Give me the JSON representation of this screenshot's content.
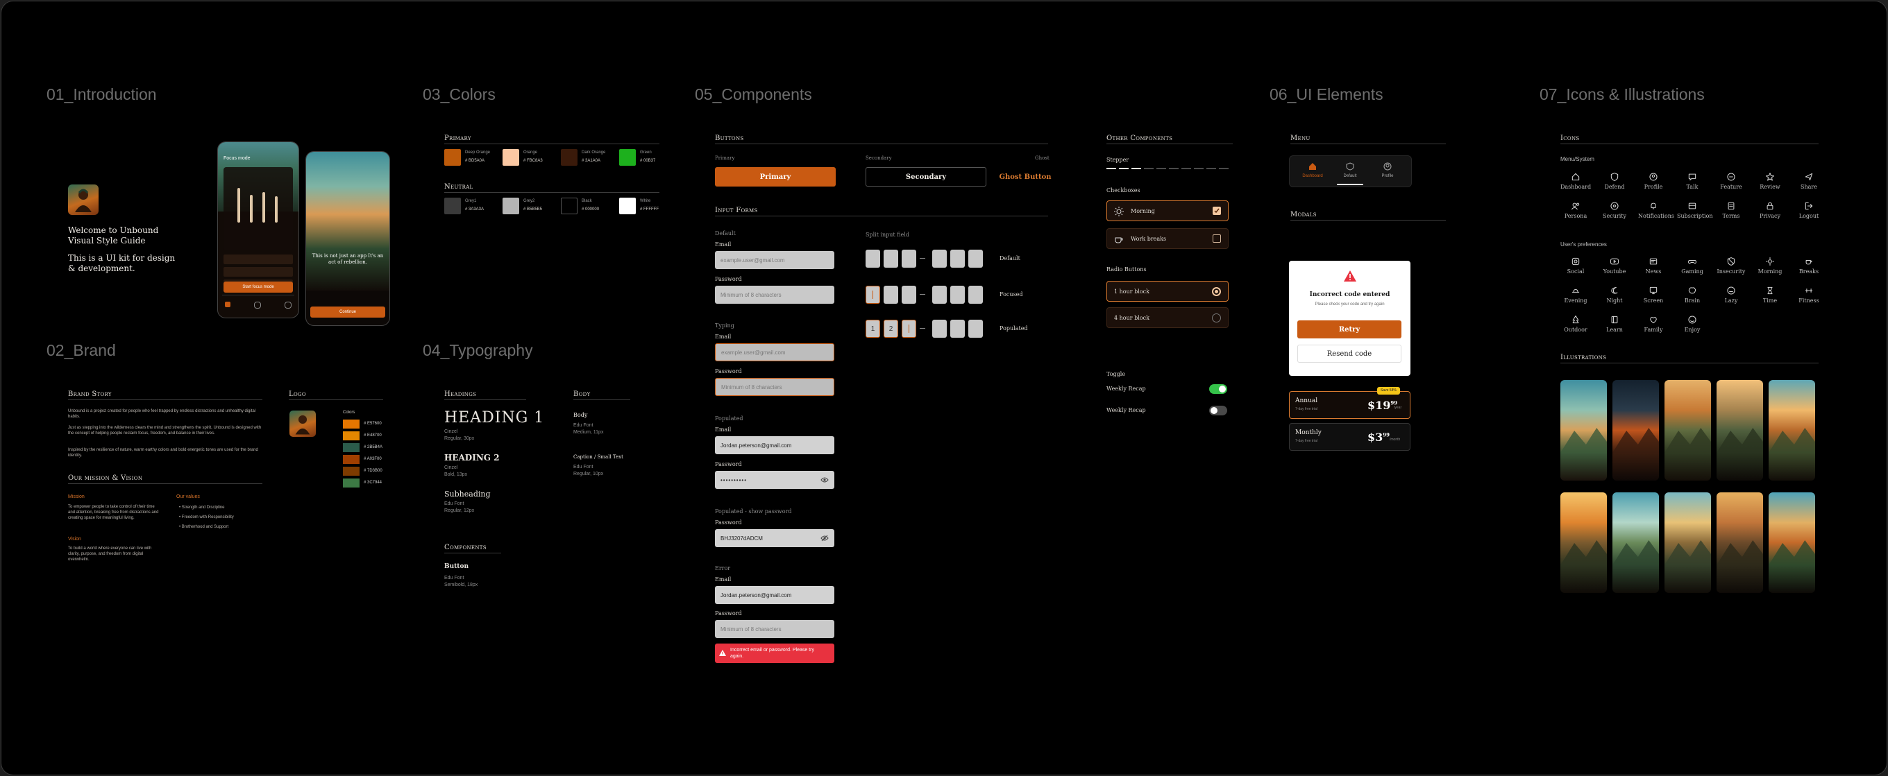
{
  "sections": {
    "intro": "01_Introduction",
    "brand": "02_Brand",
    "colors": "03_Colors",
    "typography": "04_Typography",
    "components": "05_Components",
    "ui_elements": "06_UI Elements",
    "icons": "07_Icons & Illustrations"
  },
  "intro": {
    "welcome": "Welcome to Unbound Visual Style Guide",
    "desc": "This is a UI kit for design & development.",
    "phone1": {
      "title": "Focus mode",
      "cta": "Start focus mode"
    },
    "phone2": {
      "headline": "This is not just an app It's an act of rebellion.",
      "cta": "Continue"
    }
  },
  "brand": {
    "story_title": "Brand Story",
    "story_p1": "Unbound is a project created for people who feel trapped by endless distractions and unhealthy digital habits.",
    "story_p2": "Just as stepping into the wilderness clears the mind and strengthens the spirit, Unbound is designed with the concept of helping people reclaim focus, freedom, and balance in their lives.",
    "story_p3": "Inspired by the resilience of nature, warm earthy colors and bold energetic tones are used for the brand identity.",
    "mission_vision_title": "Our mission & Vision",
    "mission_title": "Mission",
    "mission_text": "To empower people to take control of their time and attention, breaking free from distractions and creating space for meaningful living.",
    "vision_title": "Vision",
    "vision_text": "To build a world where everyone can live with clarity, purpose, and freedom from digital overwhelm.",
    "values_title": "Our values",
    "values": [
      "Strength and Discipline",
      "Freedom with Responsibility",
      "Brotherhood and Support"
    ],
    "logo_title": "Logo",
    "colors_title": "Colors",
    "logo_colors": [
      {
        "hex": "# E57600",
        "color": "#E57600"
      },
      {
        "hex": "# E48700",
        "color": "#E48700"
      },
      {
        "hex": "# 2B5B4A",
        "color": "#2B5B4A"
      },
      {
        "hex": "# A03F00",
        "color": "#A03F00"
      },
      {
        "hex": "# 7D3B00",
        "color": "#7D3B00"
      },
      {
        "hex": "# 3C7944",
        "color": "#3C7944"
      }
    ]
  },
  "colors": {
    "primary_title": "Primary",
    "primary": [
      {
        "name": "Deep Orange",
        "hex": "# BD5A0A",
        "color": "#BD5A0A"
      },
      {
        "name": "Orange",
        "hex": "# FBC8A3",
        "color": "#FBC8A3"
      },
      {
        "name": "Dark Orange",
        "hex": "# 3A1A0A",
        "color": "#3A1A0A"
      },
      {
        "name": "Green",
        "hex": "# 00B37",
        "color": "#1DB01D"
      }
    ],
    "neutral_title": "Neutral",
    "neutral": [
      {
        "name": "Grey1",
        "hex": "# 3A3A3A",
        "color": "#3A3A3A"
      },
      {
        "name": "Grey2",
        "hex": "# B5B5B5",
        "color": "#B5B5B5"
      },
      {
        "name": "Black",
        "hex": "# 000000",
        "color": "#000000"
      },
      {
        "name": "White",
        "hex": "# FFFFFF",
        "color": "#FFFFFF"
      }
    ]
  },
  "typography": {
    "headings_title": "Headings",
    "h1": "HEADING 1",
    "h1_meta": [
      "Cinzel",
      "Regular, 30px"
    ],
    "h2": "HEADING 2",
    "h2_meta": [
      "Cinzel",
      "Bold, 13px"
    ],
    "sub": "Subheading",
    "sub_meta": [
      "Edu Font",
      "Regular, 12px"
    ],
    "body_title": "Body",
    "body": "Body",
    "body_meta": [
      "Edu Font",
      "Medium, 11px"
    ],
    "caption": "Caption / Small Text",
    "caption_meta": [
      "Edu Font",
      "Regular, 10px"
    ],
    "components_title": "Components",
    "button": "Button",
    "button_meta": [
      "Edu Font",
      "Semibold, 18px"
    ]
  },
  "components": {
    "buttons_title": "Buttons",
    "primary_label": "Primary",
    "secondary_label": "Secondary",
    "ghost_label": "Ghost",
    "primary_btn": "Primary",
    "secondary_btn": "Secondary",
    "ghost_btn": "Ghost Button",
    "input_forms_title": "Input Forms",
    "default_label": "Default",
    "typing_label": "Typing",
    "populated_label": "Populated",
    "populated_show_label": "Populated - show password",
    "error_label": "Error",
    "email": "Email",
    "password": "Password",
    "email_placeholder": "example.user@gmail.com",
    "password_placeholder": "Minimum of 8 characters",
    "email_value": "Jordan.peterson@gmail.com",
    "password_dots": "••••••••••",
    "password_shown": "BHJ3207dADCM",
    "error_msg": "Incorrect email or password. Please try again.",
    "split_title": "Split input field",
    "split_default": "Default",
    "split_focused": "Focused",
    "split_populated": "Populated",
    "split_values": [
      "1",
      "2"
    ],
    "other_title": "Other Components",
    "stepper": "Stepper",
    "checkboxes": "Checkboxes",
    "cb_morning": "Morning",
    "cb_work": "Work breaks",
    "radio_title": "Radio Buttons",
    "radio_1": "1 hour block",
    "radio_2": "4 hour block",
    "toggle_title": "Toggle",
    "toggle_1": "Weekly Recap",
    "toggle_2": "Weekly Recap"
  },
  "ui": {
    "menu_title": "Menu",
    "menu_items": [
      "Dashboard",
      "Default",
      "Profile"
    ],
    "modals_title": "Modals",
    "modal_title": "Incorrect code entered",
    "modal_sub": "Please check your code and try again",
    "modal_retry": "Retry",
    "modal_resend": "Resend code",
    "plan_annual": "Annual",
    "plan_annual_sub": "7-day free trial",
    "plan_annual_price": "$19",
    "plan_annual_cents": "99",
    "plan_annual_period": "/year",
    "plan_badge": "Save 58%",
    "plan_monthly": "Monthly",
    "plan_monthly_sub": "7-day free trial",
    "plan_monthly_price": "$3",
    "plan_monthly_cents": "99",
    "plan_monthly_period": "/month"
  },
  "icons": {
    "icons_title": "Icons",
    "menu_system": "Menu/System",
    "menu_icons": [
      "Dashboard",
      "Defend",
      "Profile",
      "Talk",
      "Feature",
      "Review",
      "Share",
      "Persona",
      "Security",
      "Notifications",
      "Subscription",
      "Terms",
      "Privacy",
      "Logout"
    ],
    "user_prefs": "User's preferences",
    "pref_icons": [
      "Social",
      "Youtube",
      "News",
      "Gaming",
      "Insecurity",
      "Morning",
      "Breaks",
      "Evening",
      "Night",
      "Screen",
      "Brain",
      "Lazy",
      "Time",
      "Fitness",
      "Outdoor",
      "Learn",
      "Family",
      "Enjoy"
    ],
    "illustrations_title": "Illustrations"
  }
}
